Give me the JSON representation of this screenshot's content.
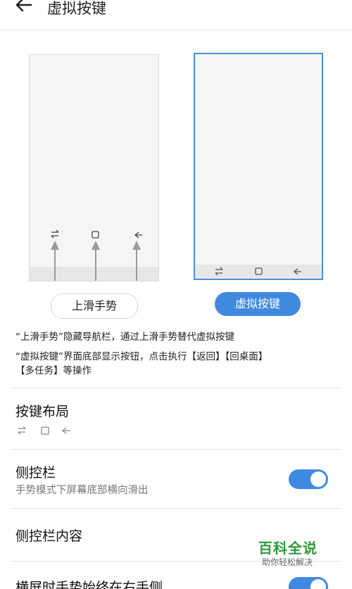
{
  "header": {
    "title": "虚拟按键"
  },
  "options": {
    "gesture_label": "上滑手势",
    "virtual_label": "虚拟按键"
  },
  "descriptions": {
    "line1": "“上滑手势”隐藏导航栏，通过上滑手势替代虚拟按键",
    "line2a": "“虚拟按键”界面底部显示按钮，点击执行【返回】【回桌面】",
    "line2b": "【多任务】等操作"
  },
  "settings": {
    "layout_title": "按键布局",
    "sidebar_title": "侧控栏",
    "sidebar_sub": "手势模式下屏幕底部横向滑出",
    "sidebar_enabled": true,
    "sidebar_content_title": "侧控栏内容",
    "landscape_title": "横屏时手势始终在右手侧",
    "landscape_enabled": true
  },
  "watermark": {
    "main": "百科全说",
    "sub": "助你轻松解决"
  },
  "icons": {
    "back": "arrow-left-icon",
    "recent": "switch-arrows-icon",
    "home": "square-icon",
    "nav_back": "chevron-left-arrow-icon",
    "swipe": "swipe-up-arrow-icon"
  }
}
